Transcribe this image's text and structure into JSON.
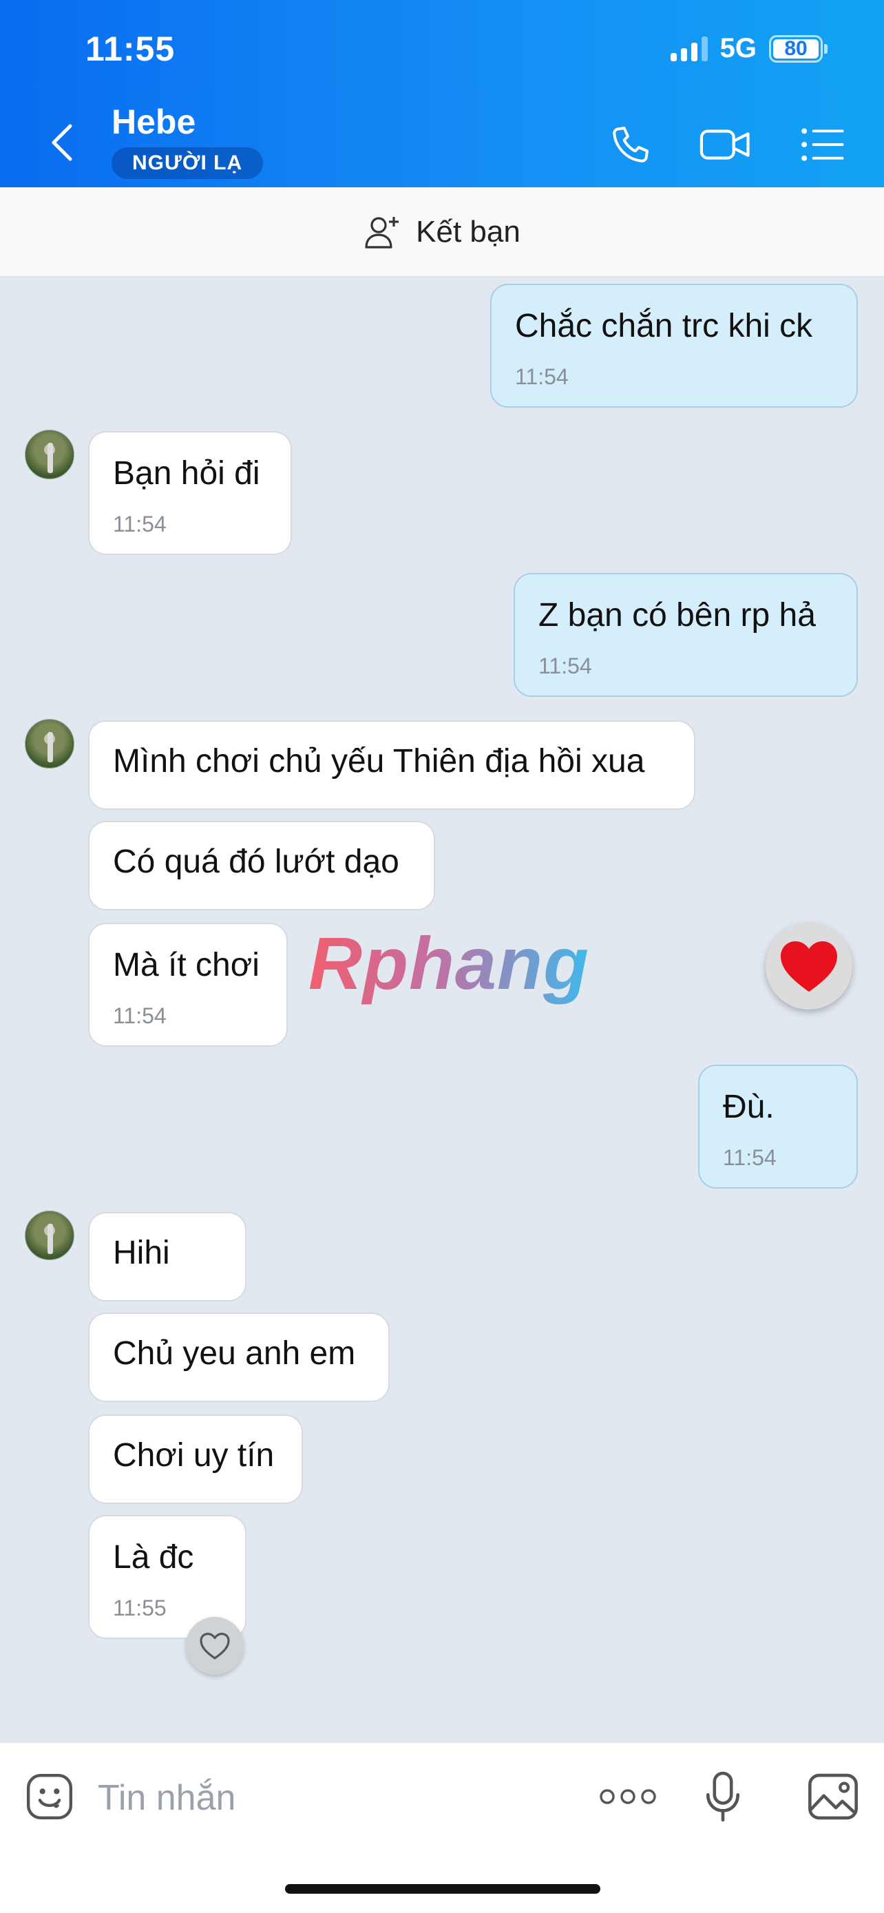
{
  "status_bar": {
    "time": "11:55",
    "network": "5G",
    "battery": "80"
  },
  "header": {
    "contact_name": "Hebe",
    "badge": "NGƯỜI LẠ"
  },
  "add_friend": {
    "label": "Kết bạn"
  },
  "messages": [
    {
      "text": "Chắc chắn trc khi ck",
      "time": "11:54"
    },
    {
      "text": "Bạn hỏi đi",
      "time": "11:54"
    },
    {
      "text": "Z bạn có bên rp hả",
      "time": "11:54"
    },
    {
      "text": "Mình chơi chủ yếu Thiên địa hồi xua"
    },
    {
      "text": "Có quá đó lướt dạo"
    },
    {
      "text": "Mà ít chơi",
      "time": "11:54"
    },
    {
      "text": "Đù.",
      "time": "11:54"
    },
    {
      "text": "Hihi"
    },
    {
      "text": "Chủ yeu anh em"
    },
    {
      "text": "Chơi uy tín"
    },
    {
      "text": "Là đc",
      "time": "11:55"
    }
  ],
  "watermark": "Rphang",
  "composer": {
    "placeholder": "Tin nhắn"
  },
  "colors": {
    "header_start": "#0a6cf0",
    "header_end": "#11a2f4",
    "outgoing_bubble": "#d5eefc",
    "incoming_bubble": "#ffffff",
    "chat_background": "#e2e8f0"
  }
}
